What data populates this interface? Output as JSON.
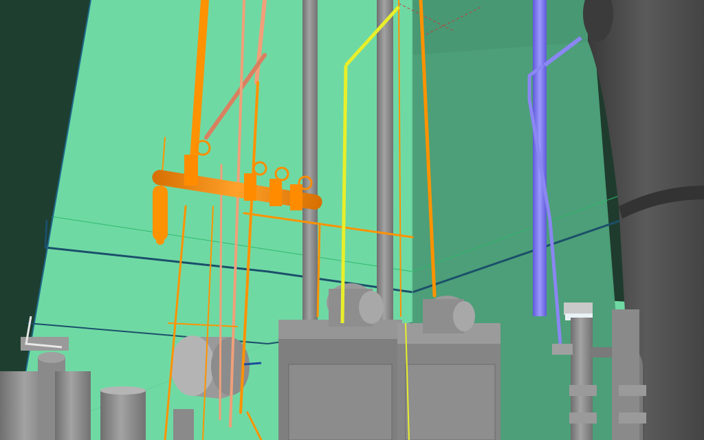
{
  "viewport": {
    "type": "3d-piping-model-render",
    "colors": {
      "back_wall": "#6fd9a4",
      "side_wall": "#4ea27a",
      "left_wall": "#1e3e30",
      "floor_edge": "#1b4f6a",
      "equipment_gray": "#8a8a8a",
      "dark_tank": "#4a4a4a",
      "pipe_orange": "#ff9200",
      "pipe_salmon": "#f0a07a",
      "pipe_yellow": "#e8ef2a",
      "pipe_purple": "#8a86f2",
      "pipe_blue": "#1a4c9a"
    }
  }
}
